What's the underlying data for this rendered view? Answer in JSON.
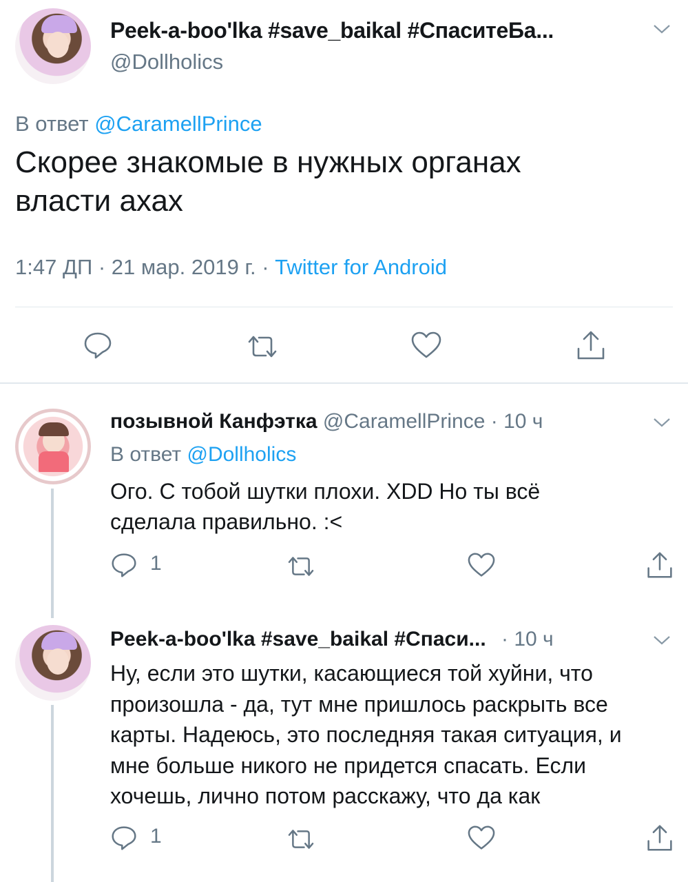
{
  "main_tweet": {
    "author_name": "Peek-a-boo'lka #save_baikal #СпаситеБа...",
    "handle": "@Dollholics",
    "reply_prefix": "В ответ",
    "reply_to": "@CaramellPrince",
    "text_line1": "Скорее знакомые в нужных органах",
    "text_line2": "власти ахах",
    "timestamp": "1:47 ДП · 21 мар. 2019 г. · ",
    "source": "Twitter for Android"
  },
  "replies": [
    {
      "author_name": "позывной Канфэтка",
      "handle": "@CaramellPrince",
      "time": "· 10 ч",
      "reply_prefix": "В ответ",
      "reply_to": "@Dollholics",
      "lines": [
        "Ого. С тобой шутки плохи. XDD Но ты всё",
        "сделала правильно. :<"
      ],
      "reply_count": "1"
    },
    {
      "author_name": "Peek-a-boo'lka #save_baikal #Спаси...",
      "time": "· 10 ч",
      "lines": [
        "Ну, если это шутки, касающиеся той хуйни, что",
        "произошла - да, тут мне пришлось раскрыть все",
        "карты. Надеюсь, это последняя такая ситуация, и",
        "мне больше никого не придется спасать. Если",
        "хочешь, лично потом расскажу, что да как"
      ],
      "reply_count": "1"
    }
  ],
  "colors": {
    "text": "#14171a",
    "secondary": "#657786",
    "accent": "#1da1f2",
    "divider": "#e1e8ed",
    "thread_line": "#ccd6dd"
  },
  "icons": [
    "reply-icon",
    "retweet-icon",
    "like-icon",
    "share-icon",
    "chevron-down-icon"
  ]
}
